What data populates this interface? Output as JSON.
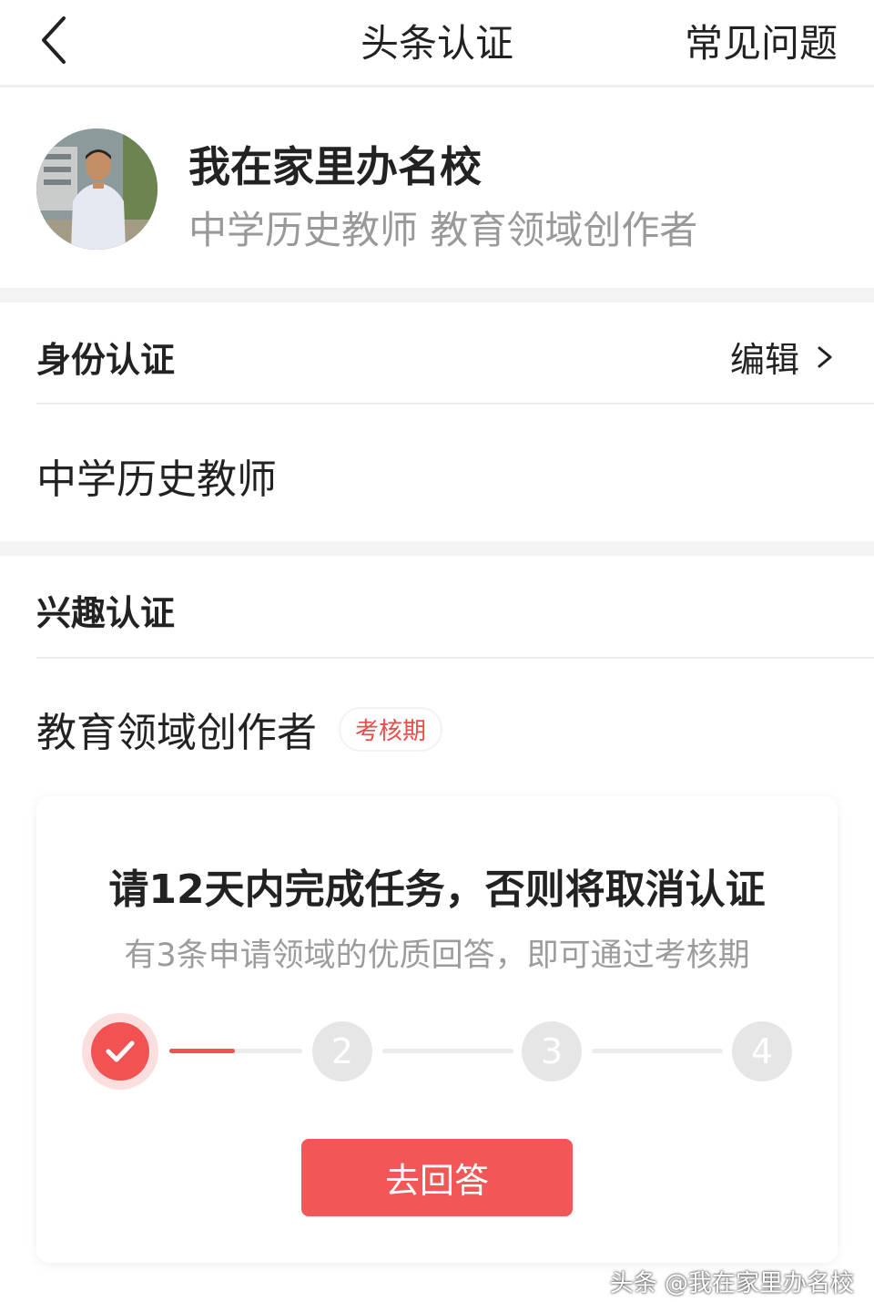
{
  "navbar": {
    "title": "头条认证",
    "faq_label": "常见问题",
    "back_icon": "chevron-left-icon"
  },
  "profile": {
    "name": "我在家里办名校",
    "subtitle": "中学历史教师 教育领域创作者"
  },
  "identity": {
    "title": "身份认证",
    "edit_label": "编辑",
    "edit_icon": "chevron-right-icon",
    "value": "中学历史教师"
  },
  "interest": {
    "title": "兴趣认证",
    "value": "教育领域创作者",
    "badge": "考核期"
  },
  "task": {
    "title": "请12天内完成任务，否则将取消认证",
    "subtitle": "有3条申请领域的优质回答，即可通过考核期",
    "steps": [
      "✓",
      "2",
      "3",
      "4"
    ],
    "completed_steps": 1,
    "button_label": "去回答",
    "accent_color": "#f25252"
  },
  "watermark": "头条 @我在家里办名校"
}
